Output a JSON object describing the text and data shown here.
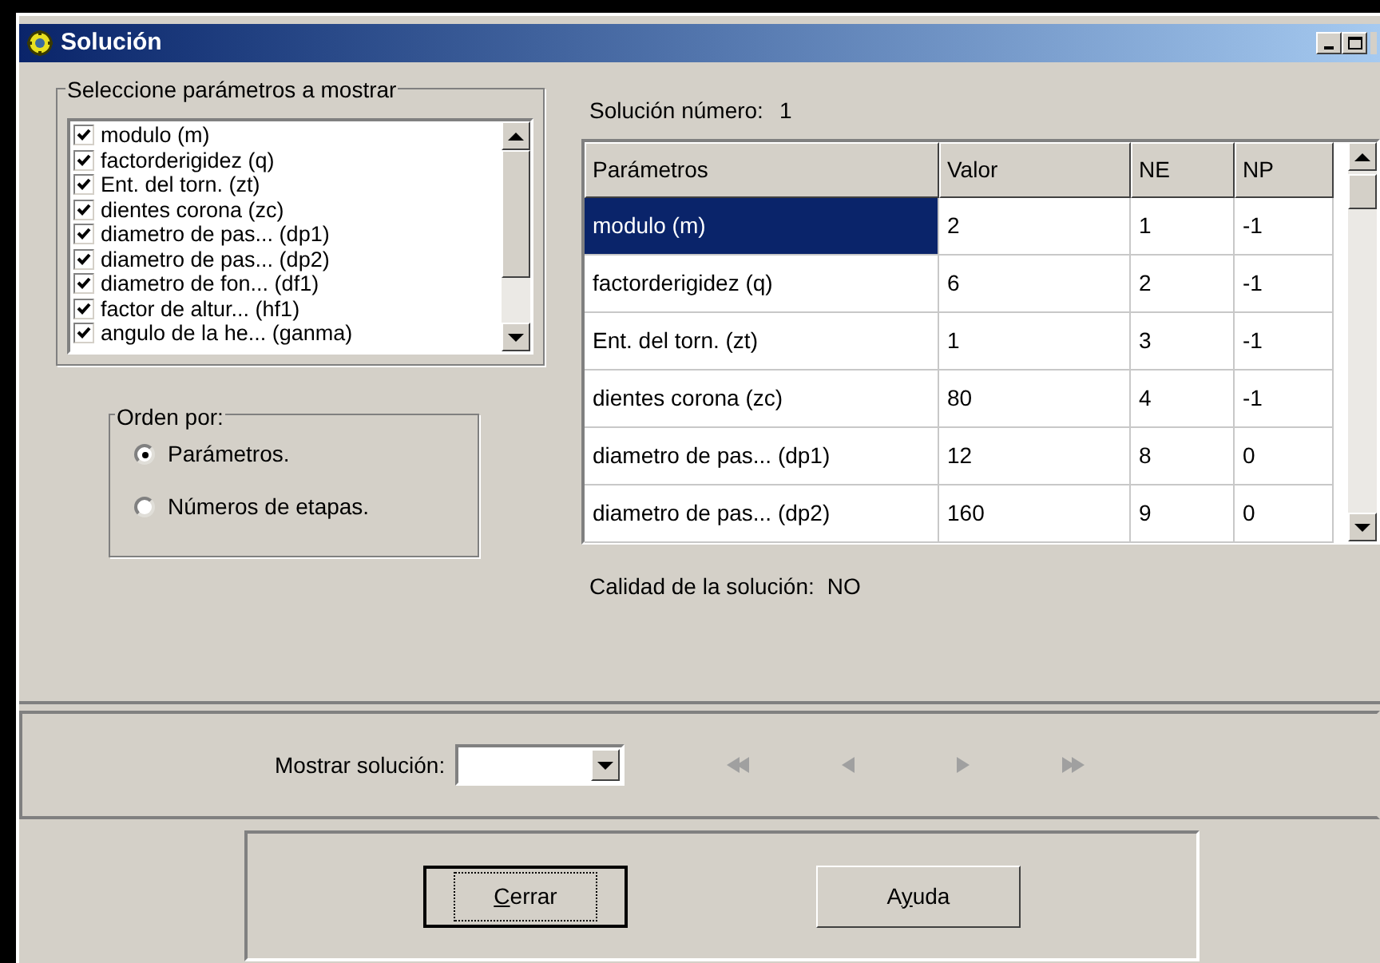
{
  "window": {
    "title": "Solución"
  },
  "parameter_group": {
    "title": "Seleccione parámetros a mostrar",
    "items": [
      {
        "label": "modulo (m)",
        "checked": true
      },
      {
        "label": "factorderigidez (q)",
        "checked": true
      },
      {
        "label": "Ent. del torn. (zt)",
        "checked": true
      },
      {
        "label": "dientes corona (zc)",
        "checked": true
      },
      {
        "label": "diametro de pas... (dp1)",
        "checked": true
      },
      {
        "label": "diametro de pas... (dp2)",
        "checked": true
      },
      {
        "label": "diametro de fon... (df1)",
        "checked": true
      },
      {
        "label": "factor de altur... (hf1)",
        "checked": true
      },
      {
        "label": "angulo de la he... (ganma)",
        "checked": true
      }
    ]
  },
  "solution_number": {
    "label": "Solución número:",
    "value": "1"
  },
  "table": {
    "columns": [
      "Parámetros",
      "Valor",
      "NE",
      "NP"
    ],
    "rows": [
      {
        "cells": [
          "modulo (m)",
          "2",
          "1",
          "-1"
        ],
        "selected": true
      },
      {
        "cells": [
          "factorderigidez (q)",
          "6",
          "2",
          "-1"
        ],
        "selected": false
      },
      {
        "cells": [
          "Ent. del torn. (zt)",
          "1",
          "3",
          "-1"
        ],
        "selected": false
      },
      {
        "cells": [
          "dientes corona (zc)",
          "80",
          "4",
          "-1"
        ],
        "selected": false
      },
      {
        "cells": [
          "diametro de pas... (dp1)",
          "12",
          "8",
          "0"
        ],
        "selected": false
      },
      {
        "cells": [
          "diametro de pas... (dp2)",
          "160",
          "9",
          "0"
        ],
        "selected": false
      }
    ]
  },
  "quality": {
    "label": "Calidad de la solución:",
    "value": "NO"
  },
  "order_group": {
    "title": "Orden por:",
    "options": [
      {
        "label": "Parámetros.",
        "selected": true
      },
      {
        "label": "Números de etapas.",
        "selected": false
      }
    ]
  },
  "show_solution": {
    "label": "Mostrar solución:"
  },
  "nav_buttons": [
    {
      "kind": "first",
      "disabled": true
    },
    {
      "kind": "prev",
      "disabled": true
    },
    {
      "kind": "next",
      "disabled": true
    },
    {
      "kind": "last",
      "disabled": true
    }
  ],
  "buttons": [
    {
      "label_parts": [
        {
          "text": "C",
          "underlined": true
        },
        {
          "text": "errar",
          "underlined": false
        }
      ],
      "focused": true
    },
    {
      "label_parts": [
        {
          "text": "A",
          "underlined": false
        },
        {
          "text": "y",
          "underlined": true
        },
        {
          "text": "uda",
          "underlined": false
        }
      ],
      "focused": false
    }
  ]
}
